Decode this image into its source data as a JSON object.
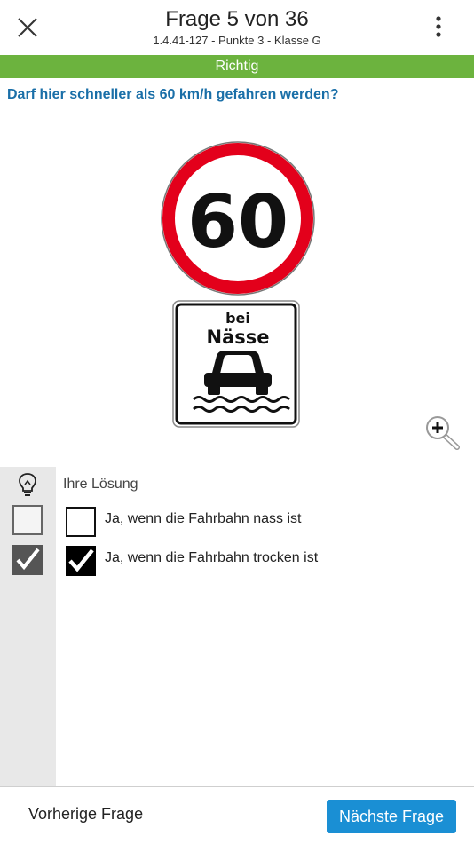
{
  "header": {
    "title": "Frage 5 von 36",
    "subtitle": "1.4.41-127 - Punkte 3 - Klasse G",
    "close_icon": "close-icon",
    "menu_icon": "more-vertical-icon"
  },
  "status": {
    "label": "Richtig",
    "color": "#6cb33e"
  },
  "question": {
    "text": "Darf hier schneller als 60 km/h gefahren werden?"
  },
  "sign": {
    "speed_limit": "60",
    "plate_line1": "bei",
    "plate_line2": "Nässe"
  },
  "solution": {
    "label": "Ihre Lösung",
    "icon": "lightbulb-icon",
    "answers": [
      {
        "text": "Ja, wenn die Fahrbahn nass ist",
        "correct": false,
        "selected": false
      },
      {
        "text": "Ja, wenn die Fahrbahn trocken ist",
        "correct": true,
        "selected": true
      }
    ]
  },
  "footer": {
    "prev_label": "Vorherige Frage",
    "next_label": "Nächste Frage"
  },
  "colors": {
    "accent": "#1a8fd4",
    "question": "#1a6fa8",
    "success": "#6cb33e"
  }
}
